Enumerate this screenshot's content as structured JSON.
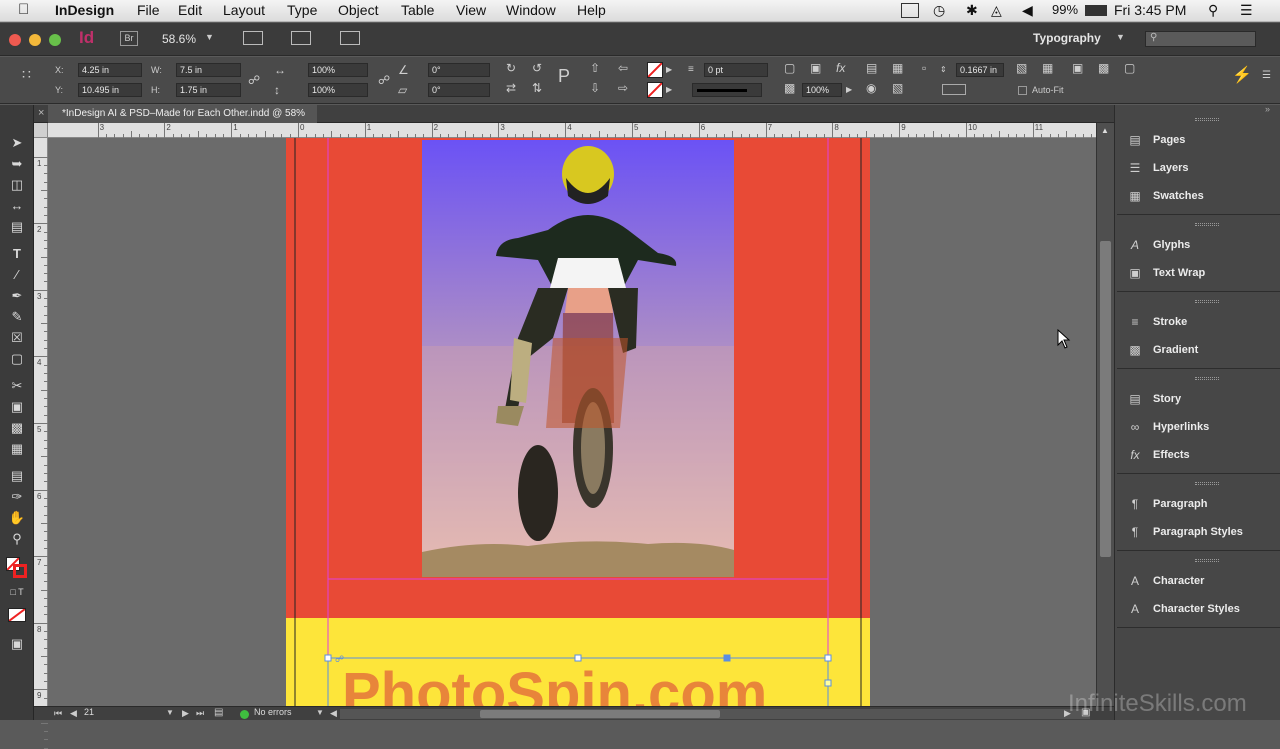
{
  "menubar": {
    "app": "InDesign",
    "items": [
      "File",
      "Edit",
      "Layout",
      "Type",
      "Object",
      "Table",
      "View",
      "Window",
      "Help"
    ],
    "battery": "99%",
    "clock": "Fri 3:45 PM"
  },
  "appbar": {
    "id_badge": "Id",
    "br_badge": "Br",
    "zoom": "58.6%",
    "workspace": "Typography",
    "search_placeholder": ""
  },
  "control": {
    "x_label": "X:",
    "x_value": "4.25 in",
    "y_label": "Y:",
    "y_value": "10.495 in",
    "w_label": "W:",
    "w_value": "7.5 in",
    "h_label": "H:",
    "h_value": "1.75 in",
    "scale_x": "100%",
    "scale_y": "100%",
    "rotate": "0°",
    "shear": "0°",
    "stroke_weight": "0 pt",
    "opacity": "100%",
    "offset": "0.1667 in",
    "autofit_label": "Auto-Fit"
  },
  "document": {
    "tab_title": "*InDesign AI & PSD–Made for Each Other.indd @ 58%",
    "headline_text": "PhotoSpin.com"
  },
  "ruler": {
    "h_numbers": [
      "3",
      "2",
      "1",
      "0",
      "1",
      "2",
      "3",
      "4",
      "5",
      "6",
      "7",
      "8",
      "9",
      "10",
      "11"
    ],
    "v_numbers": [
      "1",
      "2",
      "3",
      "4",
      "5",
      "6",
      "7",
      "8",
      "9"
    ]
  },
  "status": {
    "page": "21",
    "errors": "No errors"
  },
  "panel": {
    "groups": [
      [
        "Pages",
        "Layers",
        "Swatches"
      ],
      [
        "Glyphs",
        "Text Wrap"
      ],
      [
        "Stroke",
        "Gradient"
      ],
      [
        "Story",
        "Hyperlinks",
        "Effects"
      ],
      [
        "Paragraph",
        "Paragraph Styles"
      ],
      [
        "Character",
        "Character Styles"
      ]
    ]
  },
  "colors": {
    "page_red": "#e84a36",
    "page_yellow": "#fde53a",
    "sky_top": "#6b52f5",
    "sky_bottom": "#f0c8b8",
    "frame_magenta": "#e040e0",
    "selection_blue": "#5b8ee0"
  },
  "watermark": "InfiniteSkills.com"
}
